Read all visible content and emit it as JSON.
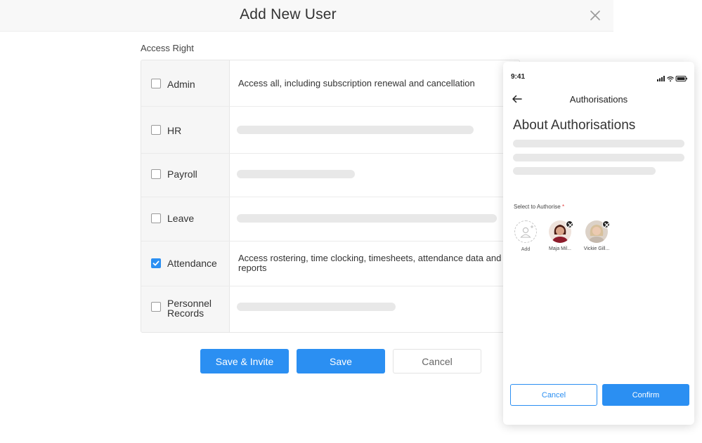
{
  "dialog": {
    "title": "Add New User",
    "close_icon": "close-icon"
  },
  "access": {
    "section_label": "Access Right",
    "rows": [
      {
        "label": "Admin",
        "checked": false,
        "description": "Access all, including subscription renewal and cancellation"
      },
      {
        "label": "HR",
        "checked": false,
        "description": ""
      },
      {
        "label": "Payroll",
        "checked": false,
        "description": ""
      },
      {
        "label": "Leave",
        "checked": false,
        "description": ""
      },
      {
        "label": "Attendance",
        "checked": true,
        "description": "Access rostering, time clocking, timesheets, attendance data and reports"
      },
      {
        "label": "Personnel Records",
        "label_line1": "Personnel",
        "label_line2": "Records",
        "checked": false,
        "description": ""
      }
    ]
  },
  "actions": {
    "save_invite": "Save & Invite",
    "save": "Save",
    "cancel": "Cancel"
  },
  "phone": {
    "status_time": "9:41",
    "nav_title": "Authorisations",
    "heading": "About Authorisations",
    "select_label": "Select to Authorise",
    "required_mark": "*",
    "add_label": "Add",
    "people": [
      {
        "name": "Maja Mil...",
        "avatar_color": "#7a1a2a"
      },
      {
        "name": "Vickie Gill...",
        "avatar_color": "#c9b7a4"
      }
    ],
    "cancel": "Cancel",
    "confirm": "Confirm"
  },
  "colors": {
    "accent": "#2b8ff2",
    "required": "#e23b3b",
    "skeleton": "#e8e8e8"
  }
}
